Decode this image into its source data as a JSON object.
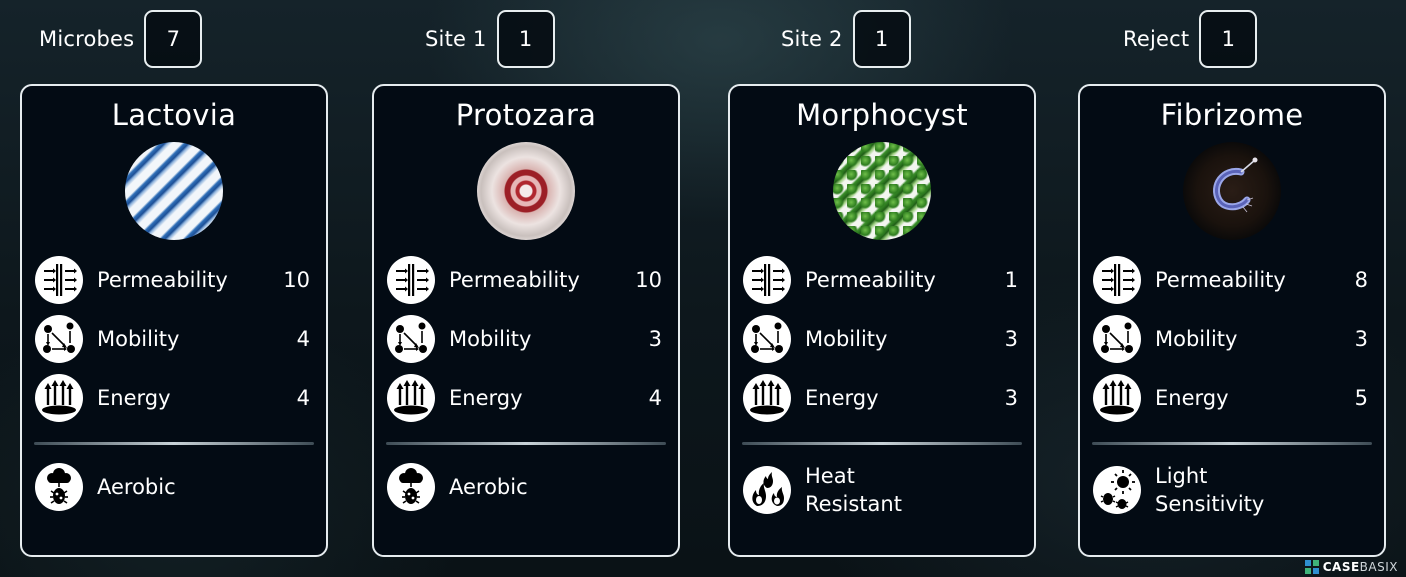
{
  "counters": [
    {
      "label": "Microbes",
      "value": "7"
    },
    {
      "label": "Site 1",
      "value": "1"
    },
    {
      "label": "Site 2",
      "value": "1"
    },
    {
      "label": "Reject",
      "value": "1"
    }
  ],
  "stat_icons": {
    "permeability": "permeability-icon",
    "mobility": "mobility-icon",
    "energy": "energy-icon"
  },
  "cards": [
    {
      "name": "Lactovia",
      "image": "lactovia-microbe-image",
      "stats": [
        {
          "label": "Permeability",
          "value": "10"
        },
        {
          "label": "Mobility",
          "value": "4"
        },
        {
          "label": "Energy",
          "value": "4"
        }
      ],
      "trait": {
        "label": "Aerobic",
        "icon": "aerobic-icon"
      }
    },
    {
      "name": "Protozara",
      "image": "protozara-microbe-image",
      "stats": [
        {
          "label": "Permeability",
          "value": "10"
        },
        {
          "label": "Mobility",
          "value": "3"
        },
        {
          "label": "Energy",
          "value": "4"
        }
      ],
      "trait": {
        "label": "Aerobic",
        "icon": "aerobic-icon"
      }
    },
    {
      "name": "Morphocyst",
      "image": "morphocyst-microbe-image",
      "stats": [
        {
          "label": "Permeability",
          "value": "1"
        },
        {
          "label": "Mobility",
          "value": "3"
        },
        {
          "label": "Energy",
          "value": "3"
        }
      ],
      "trait": {
        "label": "Heat Resistant",
        "icon": "heat-resistant-icon"
      }
    },
    {
      "name": "Fibrizome",
      "image": "fibrizome-microbe-image",
      "stats": [
        {
          "label": "Permeability",
          "value": "8"
        },
        {
          "label": "Mobility",
          "value": "3"
        },
        {
          "label": "Energy",
          "value": "5"
        }
      ],
      "trait": {
        "label": "Light Sensitivity",
        "icon": "light-sensitivity-icon"
      }
    }
  ],
  "watermark": {
    "text_a": "CASE",
    "text_b": "BASIX"
  }
}
